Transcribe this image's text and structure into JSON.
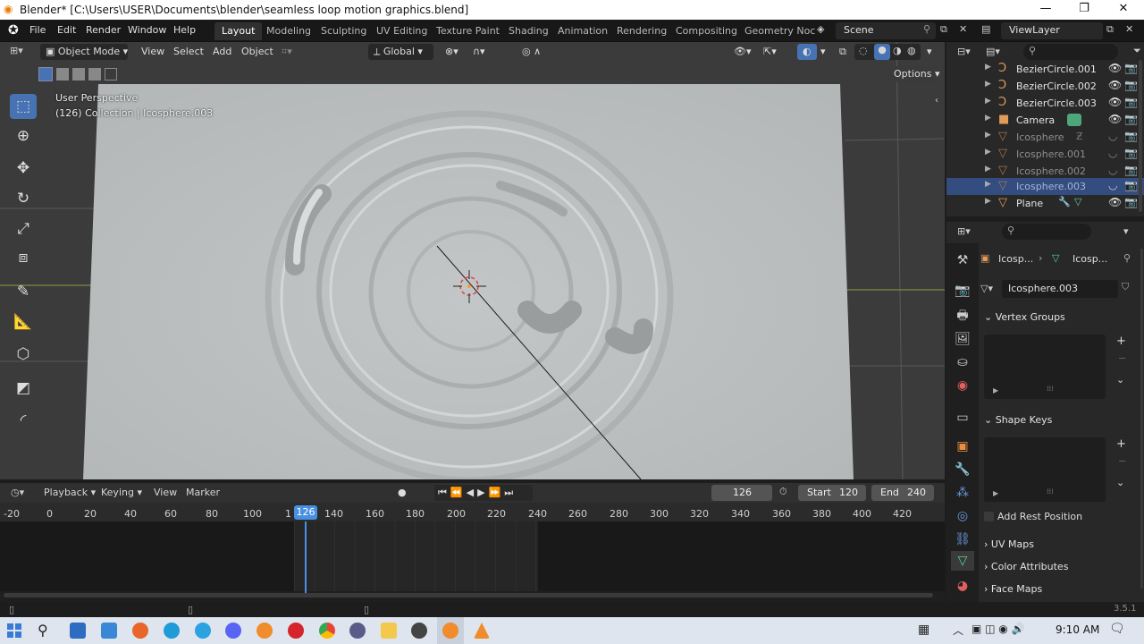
{
  "window": {
    "title": "Blender* [C:\\Users\\USER\\Documents\\blender\\seamless loop motion graphics.blend]",
    "minimize": "—",
    "maximize": "❐",
    "close": "✕"
  },
  "menu": {
    "file": "File",
    "edit": "Edit",
    "render": "Render",
    "window": "Window",
    "help": "Help"
  },
  "workspaces": [
    "Layout",
    "Modeling",
    "Sculpting",
    "UV Editing",
    "Texture Paint",
    "Shading",
    "Animation",
    "Rendering",
    "Compositing",
    "Geometry Noc"
  ],
  "scene": {
    "label": "Scene",
    "viewlayer": "ViewLayer"
  },
  "viewport": {
    "mode": "Object Mode",
    "view": "View",
    "select": "Select",
    "add": "Add",
    "object": "Object",
    "orientation": "Global",
    "options": "Options",
    "perspective": "User Perspective",
    "collection_info": "(126) Collection | Icosphere.003"
  },
  "outliner": {
    "items": [
      {
        "name": "BezierCircle.001",
        "icon": "curve-icon",
        "glyph": "Ͻ"
      },
      {
        "name": "BezierCircle.002",
        "icon": "curve-icon",
        "glyph": "Ͻ"
      },
      {
        "name": "BezierCircle.003",
        "icon": "curve-icon",
        "glyph": "Ͻ"
      },
      {
        "name": "Camera",
        "icon": "camera-icon",
        "glyph": "■"
      },
      {
        "name": "Icosphere",
        "icon": "mesh-icon",
        "glyph": "▽"
      },
      {
        "name": "Icosphere.001",
        "icon": "mesh-icon",
        "glyph": "▽"
      },
      {
        "name": "Icosphere.002",
        "icon": "mesh-icon",
        "glyph": "▽"
      },
      {
        "name": "Icosphere.003",
        "icon": "mesh-icon",
        "glyph": "▽"
      },
      {
        "name": "Plane",
        "icon": "mesh-icon",
        "glyph": "▽"
      }
    ]
  },
  "properties": {
    "breadcrumb_1": "Icosp...",
    "breadcrumb_2": "Icosp...",
    "mesh_name": "Icosphere.003",
    "vertex_groups": "Vertex Groups",
    "shape_keys": "Shape Keys",
    "add_rest_position": "Add Rest Position",
    "uv_maps": "UV Maps",
    "color_attributes": "Color Attributes",
    "face_maps": "Face Maps"
  },
  "timeline": {
    "playback": "Playback",
    "keying": "Keying",
    "view": "View",
    "marker": "Marker",
    "current_frame": "126",
    "start_label": "Start",
    "start": "120",
    "end_label": "End",
    "end": "240",
    "ticks": [
      "-20",
      "0",
      "20",
      "40",
      "60",
      "80",
      "100",
      "1",
      "140",
      "160",
      "180",
      "200",
      "220",
      "240",
      "260",
      "280",
      "300",
      "320",
      "340",
      "360",
      "380",
      "400",
      "420"
    ]
  },
  "status": {
    "version": "3.5.1"
  },
  "taskbar": {
    "time": "9:10 AM"
  },
  "colors": {
    "accent": "#4772b3",
    "selected_row": "#334d80",
    "frame_marker": "#4a90e2"
  }
}
